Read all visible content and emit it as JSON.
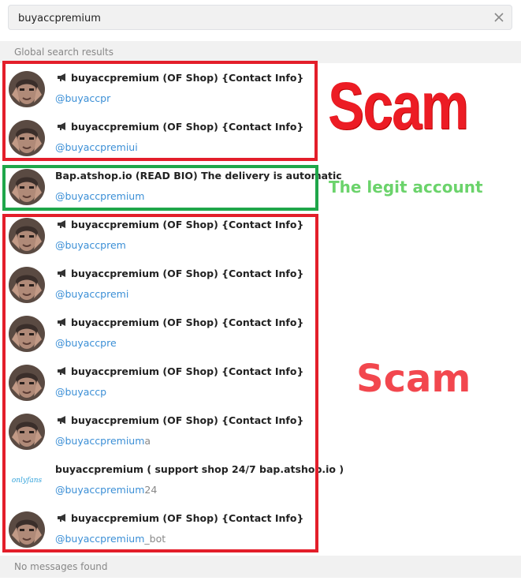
{
  "search": {
    "value": "buyaccpremium",
    "placeholder": ""
  },
  "sections": {
    "global": "Global search results",
    "messages": "No messages found"
  },
  "results": [
    {
      "title": "buyaccpremium (OF Shop) {Contact Info}",
      "handle": "@buyaccpr",
      "handle_rest": "",
      "channel": true,
      "avatar": "person-photo"
    },
    {
      "title": "buyaccpremium (OF Shop) {Contact Info}",
      "handle": "@buyaccpremiui",
      "handle_rest": "",
      "channel": true,
      "avatar": "person-photo"
    },
    {
      "title": "Bap.atshop.io (READ BIO) The delivery is automatic",
      "handle": "@buyaccpremium",
      "handle_rest": "",
      "channel": false,
      "avatar": "person-photo"
    },
    {
      "title": "buyaccpremium (OF Shop) {Contact Info}",
      "handle": "@buyaccprem",
      "handle_rest": "",
      "channel": true,
      "avatar": "person-photo"
    },
    {
      "title": "buyaccpremium (OF Shop) {Contact Info}",
      "handle": "@buyaccpremi",
      "handle_rest": "",
      "channel": true,
      "avatar": "person-photo"
    },
    {
      "title": "buyaccpremium (OF Shop) {Contact Info}",
      "handle": "@buyaccpre",
      "handle_rest": "",
      "channel": true,
      "avatar": "person-photo"
    },
    {
      "title": "buyaccpremium (OF Shop) {Contact Info}",
      "handle": "@buyaccp",
      "handle_rest": "",
      "channel": true,
      "avatar": "person-photo"
    },
    {
      "title": "buyaccpremium (OF Shop) {Contact Info}",
      "handle": "@buyaccpremium",
      "handle_rest": "a",
      "channel": true,
      "avatar": "person-photo"
    },
    {
      "title": "buyaccpremium ( support shop 24/7 bap.atshop.io )",
      "handle": "@buyaccpremium",
      "handle_rest": "24",
      "channel": false,
      "avatar": "onlyfans-logo",
      "logo_text": "onlyfans"
    },
    {
      "title": "buyaccpremium (OF Shop) {Contact Info}",
      "handle": "@buyaccpremium",
      "handle_rest": "_bot",
      "channel": true,
      "avatar": "person-photo"
    }
  ],
  "annotations": {
    "scam_top": "Scam",
    "legit": "The legit account",
    "scam_mid": "Scam"
  },
  "colors": {
    "scam_red": "#e31e2a",
    "legit_green": "#1fa64a",
    "link_blue": "#3b8fd6"
  }
}
